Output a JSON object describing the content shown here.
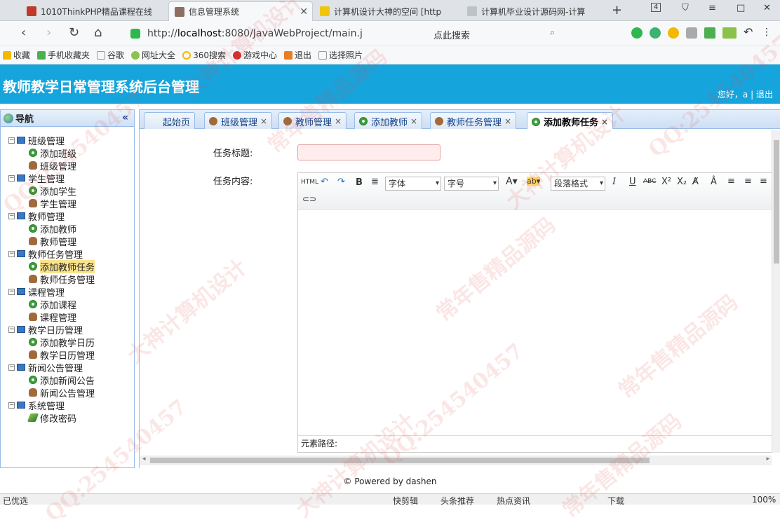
{
  "browser": {
    "tabs": [
      {
        "label": "1010ThinkPHP精品课程在线",
        "color": "#c0392b"
      },
      {
        "label": "信息管理系统",
        "color": "#8d6e63"
      },
      {
        "label": "计算机设计大神的空间 [http",
        "color": "#f1c40f"
      },
      {
        "label": "计算机毕业设计源码网-计算",
        "color": "#7f8c8d"
      }
    ],
    "tab_count": "4",
    "url_prefix": "http://",
    "url_host": "localhost",
    "url_rest": ":8080/JavaWebProject/main.j",
    "search_placeholder": "点此搜索",
    "bookmarks": [
      "收藏",
      "手机收藏夹",
      "谷歌",
      "网址大全",
      "360搜索",
      "游戏中心",
      "退出",
      "选择照片"
    ]
  },
  "app": {
    "title": "教师教学日常管理系统后台管理",
    "greeting": "您好，a",
    "separator": "|",
    "logout": "退出"
  },
  "sidebar": {
    "title": "导航",
    "collapse_icon": "«",
    "groups": [
      {
        "label": "班级管理",
        "items": [
          {
            "label": "添加班级",
            "icon": "add"
          },
          {
            "label": "班级管理",
            "icon": "user"
          }
        ]
      },
      {
        "label": "学生管理",
        "items": [
          {
            "label": "添加学生",
            "icon": "add"
          },
          {
            "label": "学生管理",
            "icon": "user"
          }
        ]
      },
      {
        "label": "教师管理",
        "items": [
          {
            "label": "添加教师",
            "icon": "add"
          },
          {
            "label": "教师管理",
            "icon": "user"
          }
        ]
      },
      {
        "label": "教师任务管理",
        "items": [
          {
            "label": "添加教师任务",
            "icon": "add"
          },
          {
            "label": "教师任务管理",
            "icon": "user"
          }
        ]
      },
      {
        "label": "课程管理",
        "items": [
          {
            "label": "添加课程",
            "icon": "add"
          },
          {
            "label": "课程管理",
            "icon": "user"
          }
        ]
      },
      {
        "label": "教学日历管理",
        "items": [
          {
            "label": "添加教学日历",
            "icon": "add"
          },
          {
            "label": "教学日历管理",
            "icon": "user"
          }
        ]
      },
      {
        "label": "新闻公告管理",
        "items": [
          {
            "label": "添加新闻公告",
            "icon": "add"
          },
          {
            "label": "新闻公告管理",
            "icon": "user"
          }
        ]
      },
      {
        "label": "系统管理",
        "items": [
          {
            "label": "修改密码",
            "icon": "pen"
          }
        ]
      }
    ],
    "selected": "添加教师任务"
  },
  "content_tabs": [
    {
      "label": "起始页",
      "closable": false,
      "icon": ""
    },
    {
      "label": "班级管理",
      "closable": true,
      "icon": "user"
    },
    {
      "label": "教师管理",
      "closable": true,
      "icon": "user"
    },
    {
      "label": "添加教师",
      "closable": true,
      "icon": "add"
    },
    {
      "label": "教师任务管理",
      "closable": true,
      "icon": "user"
    },
    {
      "label": "添加教师任务",
      "closable": true,
      "icon": "add",
      "active": true
    }
  ],
  "form": {
    "title_label": "任务标题:",
    "title_value": "",
    "content_label": "任务内容:",
    "editor": {
      "html_btn": "HTML",
      "font_family": "字体",
      "font_size": "字号",
      "paragraph": "段落格式",
      "element_path": "元素路径:"
    }
  },
  "footer": "© Powered by dashen",
  "statusbar": {
    "left": "已优选",
    "items": [
      "快剪辑",
      "头条推荐",
      "热点资讯",
      "下载",
      "100%"
    ]
  },
  "watermark": {
    "lines": [
      "QQ:254540457",
      "大神计算机设计",
      "常年售精品源码"
    ]
  },
  "colors": {
    "header": "#16a4dc",
    "selected": "#fbe48c"
  }
}
